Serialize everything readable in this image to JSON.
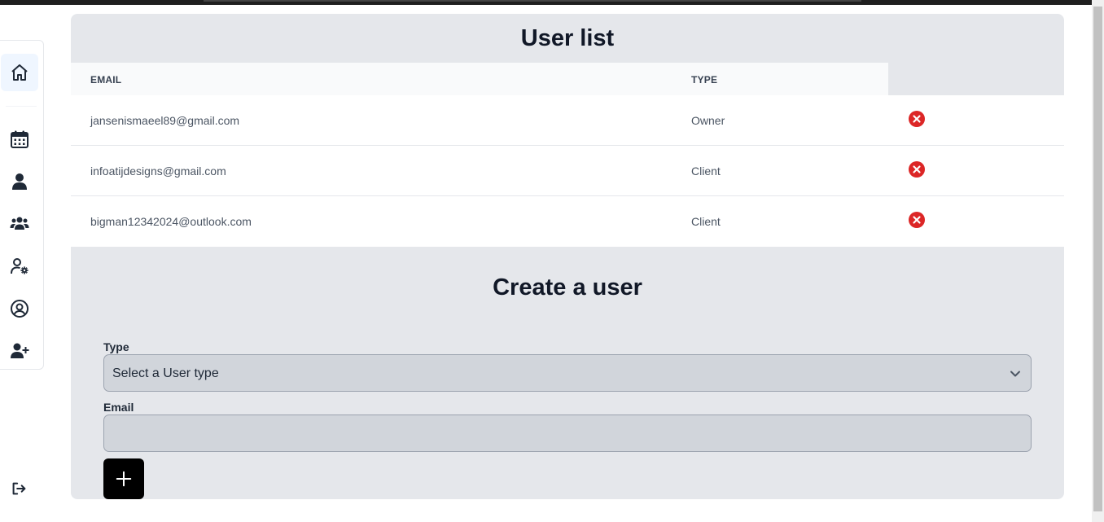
{
  "user_list": {
    "title": "User list",
    "columns": {
      "email": "EMAIL",
      "type": "TYPE"
    },
    "rows": [
      {
        "email": "jansenismaeel89@gmail.com",
        "type": "Owner"
      },
      {
        "email": "infoatijdesigns@gmail.com",
        "type": "Client"
      },
      {
        "email": "bigman12342024@outlook.com",
        "type": "Client"
      }
    ]
  },
  "create_user": {
    "title": "Create a user",
    "type_label": "Type",
    "type_selected": "Select a User type",
    "email_label": "Email",
    "email_value": ""
  },
  "sidebar": {
    "items": [
      {
        "icon": "home-icon",
        "active": true
      },
      {
        "icon": "calendar-icon"
      },
      {
        "icon": "user-icon"
      },
      {
        "icon": "users-group-icon"
      },
      {
        "icon": "user-settings-icon"
      },
      {
        "icon": "user-circle-icon"
      },
      {
        "icon": "user-plus-icon"
      }
    ],
    "logout_icon": "logout-icon"
  },
  "colors": {
    "panel_bg": "#e5e7eb",
    "delete_red": "#dc2626",
    "active_bg": "#eff6ff",
    "add_button": "#000000"
  }
}
